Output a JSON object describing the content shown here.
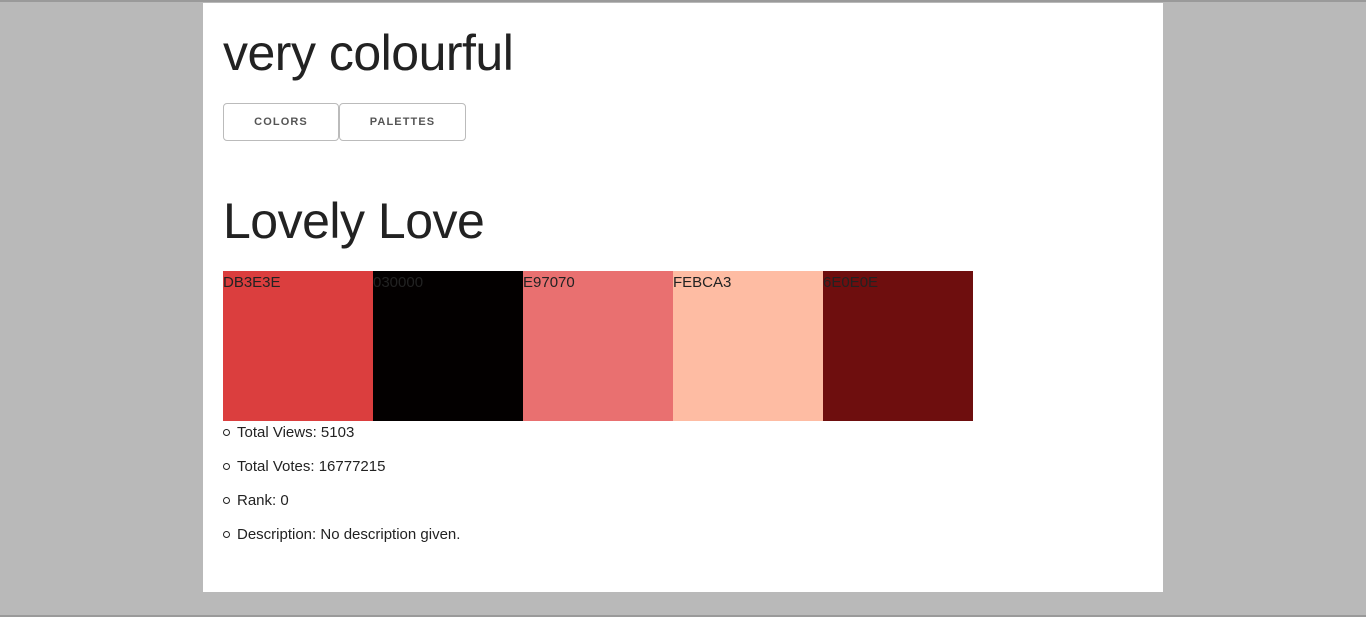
{
  "site": {
    "title": "very colourful"
  },
  "nav": {
    "items": [
      {
        "label": "COLORS"
      },
      {
        "label": "PALETTES"
      }
    ]
  },
  "palette": {
    "title": "Lovely Love",
    "swatches": [
      {
        "hex": "DB3E3E",
        "color": "#DB3E3E"
      },
      {
        "hex": "030000",
        "color": "#030000"
      },
      {
        "hex": "E97070",
        "color": "#E97070"
      },
      {
        "hex": "FEBCA3",
        "color": "#FEBCA3"
      },
      {
        "hex": "6E0E0E",
        "color": "#6E0E0E"
      }
    ],
    "stats": [
      {
        "text": "Total Views: 5103"
      },
      {
        "text": "Total Votes: 16777215"
      },
      {
        "text": "Rank: 0"
      },
      {
        "text": "Description: No description given."
      }
    ]
  }
}
